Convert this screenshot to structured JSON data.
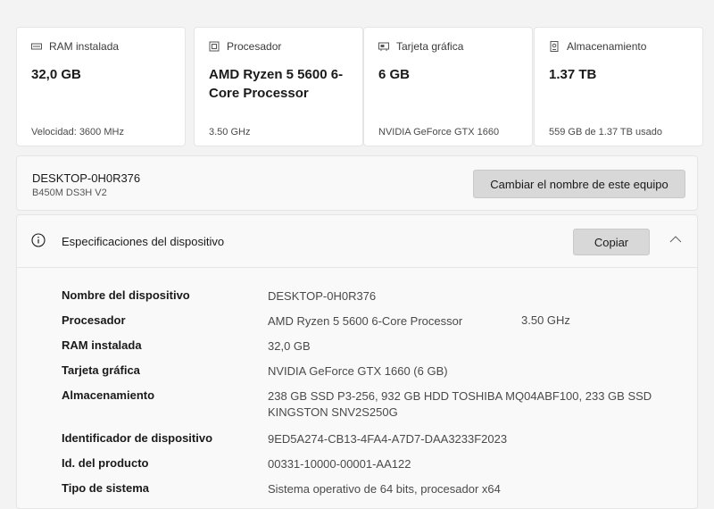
{
  "cards": [
    {
      "label": "RAM instalada",
      "value": "32,0 GB",
      "footer": "Velocidad: 3600 MHz",
      "icon": "ram-icon"
    },
    {
      "label": "Procesador",
      "value": "AMD Ryzen 5 5600 6-Core Processor",
      "footer": "3.50 GHz",
      "icon": "processor-icon"
    },
    {
      "label": "Tarjeta gráfica",
      "value": "6 GB",
      "footer": "NVIDIA GeForce GTX 1660",
      "icon": "graphics-card-icon"
    },
    {
      "label": "Almacenamiento",
      "value": "1.37 TB",
      "footer": "559 GB de 1.37 TB usado",
      "icon": "storage-icon"
    }
  ],
  "device": {
    "name": "DESKTOP-0H0R376",
    "model": "B450M DS3H V2",
    "rename_label": "Cambiar el nombre de este equipo"
  },
  "specs": {
    "title": "Especificaciones del dispositivo",
    "copy_label": "Copiar",
    "rows": [
      {
        "label": "Nombre del dispositivo",
        "value": "DESKTOP-0H0R376",
        "extra": ""
      },
      {
        "label": "Procesador",
        "value": "AMD Ryzen 5 5600 6-Core Processor",
        "extra": "3.50 GHz"
      },
      {
        "label": "RAM instalada",
        "value": "32,0 GB",
        "extra": ""
      },
      {
        "label": "Tarjeta gráfica",
        "value": "NVIDIA GeForce GTX 1660 (6 GB)",
        "extra": ""
      },
      {
        "label": "Almacenamiento",
        "value": "238 GB SSD P3-256, 932 GB HDD TOSHIBA MQ04ABF100, 233 GB SSD KINGSTON SNV2S250G",
        "extra": ""
      },
      {
        "label": "Identificador de dispositivo",
        "value": "9ED5A274-CB13-4FA4-A7D7-DAA3233F2023",
        "extra": ""
      },
      {
        "label": "Id. del producto",
        "value": "00331-10000-00001-AA122",
        "extra": ""
      },
      {
        "label": "Tipo de sistema",
        "value": "Sistema operativo de 64 bits, procesador x64",
        "extra": ""
      }
    ]
  }
}
